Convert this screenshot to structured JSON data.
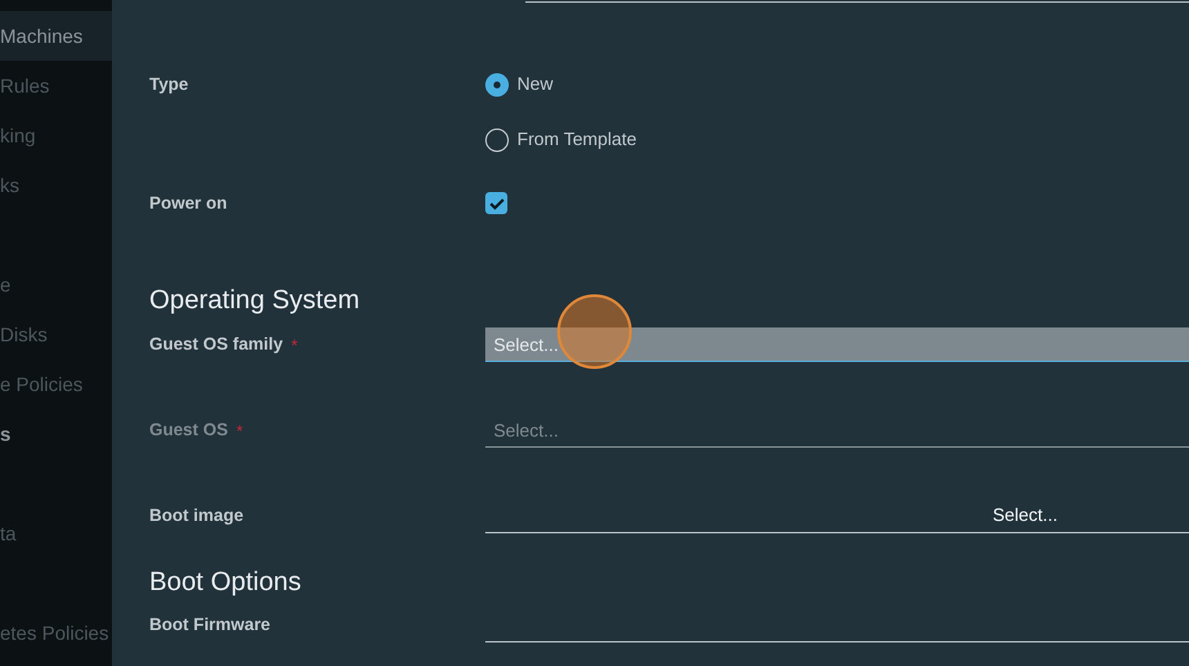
{
  "sidebar": {
    "groups": [
      {
        "items": [
          {
            "label": "Machines",
            "selected": true,
            "kind": "item"
          },
          {
            "label": "Rules",
            "selected": false,
            "kind": "item"
          },
          {
            "label": "king",
            "selected": false,
            "kind": "item"
          },
          {
            "label": "ks",
            "selected": false,
            "kind": "item"
          }
        ]
      },
      {
        "items": [
          {
            "label": "e",
            "selected": false,
            "kind": "item"
          },
          {
            "label": "Disks",
            "selected": false,
            "kind": "item"
          },
          {
            "label": "e Policies",
            "selected": false,
            "kind": "item"
          },
          {
            "label": "s",
            "selected": false,
            "kind": "header"
          }
        ]
      },
      {
        "items": [
          {
            "label": "ta",
            "selected": false,
            "kind": "item"
          }
        ]
      },
      {
        "items": [
          {
            "label": "etes Policies",
            "selected": false,
            "kind": "item"
          }
        ]
      }
    ]
  },
  "form": {
    "type": {
      "label": "Type",
      "options": [
        {
          "label": "New",
          "selected": true
        },
        {
          "label": "From Template",
          "selected": false
        }
      ]
    },
    "power_on": {
      "label": "Power on",
      "checked": true
    },
    "os_section": {
      "title": "Operating System",
      "fields": [
        {
          "label": "Guest OS family",
          "required_mark": "*",
          "placeholder": "Select...",
          "focused": true,
          "disabled": false
        },
        {
          "label": "Guest OS",
          "required_mark": "*",
          "placeholder": "Select...",
          "focused": false,
          "disabled": true
        }
      ],
      "boot_image": {
        "label": "Boot image",
        "button": "Select..."
      }
    },
    "boot_section": {
      "title": "Boot Options",
      "fields": [
        {
          "label": "Boot Firmware"
        }
      ]
    }
  }
}
